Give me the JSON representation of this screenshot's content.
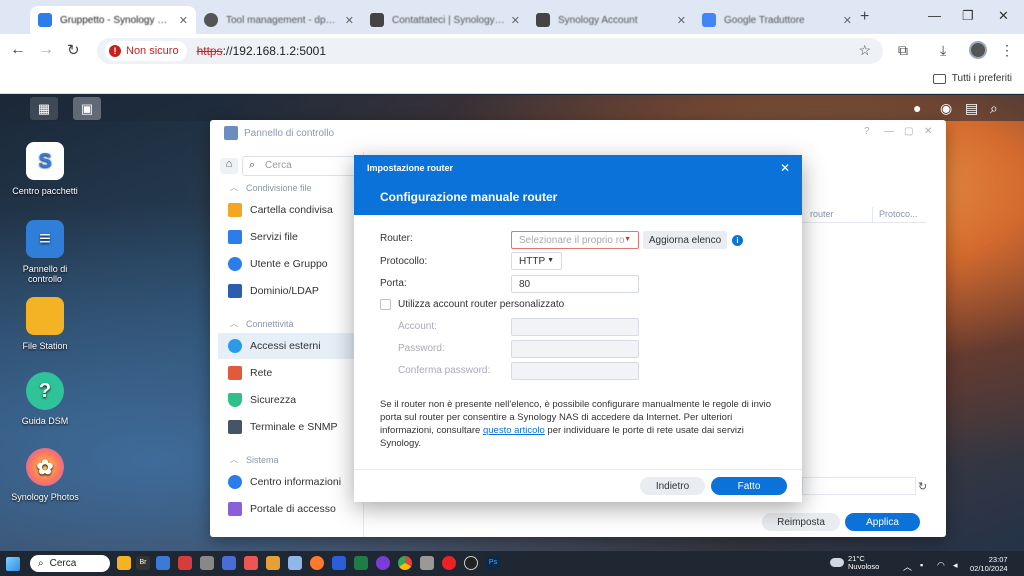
{
  "browser": {
    "tabs": [
      {
        "label": "Gruppetto - Synology NAS",
        "active": true,
        "color": "#2b7de9"
      },
      {
        "label": "Tool management - dp-01",
        "active": false,
        "color": "#555555"
      },
      {
        "label": "Contattateci | Synology Inc.",
        "active": false,
        "color": "#444444"
      },
      {
        "label": "Synology Account",
        "active": false,
        "color": "#444444"
      },
      {
        "label": "Google Traduttore",
        "active": false,
        "color": "#4285f4"
      }
    ],
    "security_label": "Non sicuro",
    "url_scheme": "https",
    "url_rest": "://192.168.1.2:5001",
    "bookmarks_all": "Tutti i preferiti"
  },
  "desktop": {
    "icons": [
      {
        "label": "Centro pacchetti",
        "glyph": "S",
        "color": "#ffffff",
        "text_color": "#2b7de9"
      },
      {
        "label": "Pannello di controllo",
        "glyph": "≡",
        "color": "#2f7fd8",
        "text_color": "#ffffff"
      },
      {
        "label": "File Station",
        "glyph": "",
        "color": "#f4b324",
        "text_color": "#ffffff"
      },
      {
        "label": "Guida DSM",
        "glyph": "?",
        "color": "#2fc39a",
        "text_color": "#ffffff"
      },
      {
        "label": "Synology Photos",
        "glyph": "✿",
        "color": "#ff7a59",
        "text_color": "#ffffff"
      }
    ]
  },
  "control_panel": {
    "title": "Pannello di controllo",
    "search_placeholder": "Cerca",
    "sections": [
      {
        "label": "Condivisione file",
        "items": [
          {
            "label": "Cartella condivisa",
            "icon": "folder-icon",
            "color": "#f4a623"
          },
          {
            "label": "Servizi file",
            "icon": "file-services-icon",
            "color": "#2b7de9"
          },
          {
            "label": "Utente e Gruppo",
            "icon": "users-icon",
            "color": "#2b7de9"
          },
          {
            "label": "Dominio/LDAP",
            "icon": "domain-icon",
            "color": "#2b5fae"
          }
        ]
      },
      {
        "label": "Connettività",
        "items": [
          {
            "label": "Accessi esterni",
            "icon": "globe-icon",
            "color": "#2b9be9",
            "selected": true
          },
          {
            "label": "Rete",
            "icon": "network-icon",
            "color": "#e05b3a"
          },
          {
            "label": "Sicurezza",
            "icon": "shield-icon",
            "color": "#2fbf8a"
          },
          {
            "label": "Terminale e SNMP",
            "icon": "terminal-icon",
            "color": "#445566"
          }
        ]
      },
      {
        "label": "Sistema",
        "items": [
          {
            "label": "Centro informazioni",
            "icon": "info-icon",
            "color": "#2b7de9"
          },
          {
            "label": "Portale di accesso",
            "icon": "portal-icon",
            "color": "#8a5fd8"
          }
        ]
      }
    ],
    "table_headers": [
      "router",
      "Protoco..."
    ],
    "reset_label": "Reimposta",
    "apply_label": "Applica"
  },
  "dialog": {
    "header_small": "Impostazione router",
    "title": "Configurazione manuale router",
    "router_label": "Router:",
    "router_placeholder": "Selezionare il proprio rou",
    "refresh_list_label": "Aggiorna elenco",
    "protocol_label": "Protocollo:",
    "protocol_value": "HTTP",
    "port_label": "Porta:",
    "port_value": "80",
    "custom_account_label": "Utilizza account router personalizzato",
    "account_label": "Account:",
    "password_label": "Password:",
    "confirm_password_label": "Conferma password:",
    "description_before": "Se il router non è presente nell'elenco, è possibile configurare manualmente le regole di invio porta sul router per consentire a Synology NAS di accedere da Internet. Per ulteriori informazioni, consultare ",
    "description_link": "questo articolo",
    "description_after": " per individuare le porte di rete usate dai servizi Synology.",
    "back_label": "Indietro",
    "done_label": "Fatto",
    "accent_color": "#0b72d9"
  },
  "taskbar": {
    "search_label": "Cerca",
    "weather_temp": "21°C",
    "weather_desc": "Nuvoloso",
    "time": "23:07",
    "date": "02/10/2024"
  }
}
